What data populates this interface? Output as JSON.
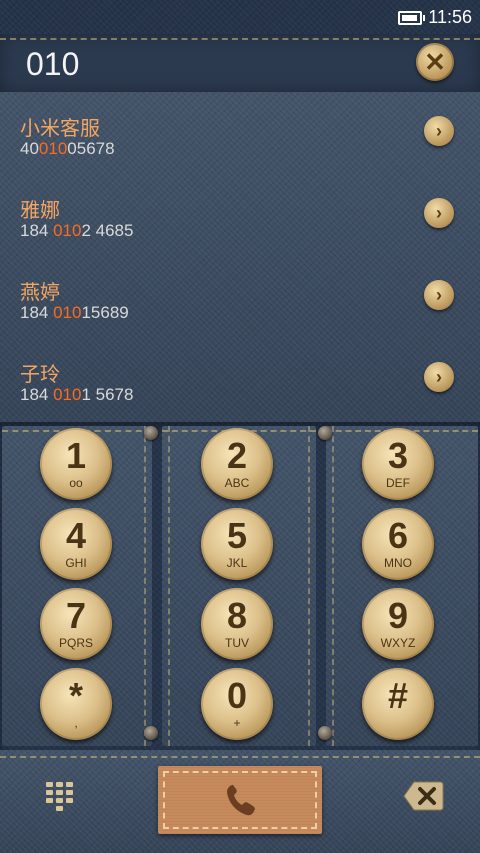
{
  "status_bar": {
    "time": "11:56",
    "icons": [
      "battery-icon"
    ]
  },
  "dial_input": {
    "value": "010",
    "clear_icon": "close-icon"
  },
  "contacts": [
    {
      "name": "小米客服",
      "number_prefix": "40",
      "number_match": "010",
      "number_suffix": "05678"
    },
    {
      "name": "雅娜",
      "number_prefix": "184 ",
      "number_match": "010",
      "number_suffix": "2 4685"
    },
    {
      "name": "燕婷",
      "number_prefix": "184 ",
      "number_match": "010",
      "number_suffix": "15689"
    },
    {
      "name": "子玲",
      "number_prefix": "184 ",
      "number_match": "010",
      "number_suffix": "1 5678"
    }
  ],
  "keypad": {
    "keys": [
      {
        "digit": "1",
        "letters": "ᴏᴏ"
      },
      {
        "digit": "2",
        "letters": "ABC"
      },
      {
        "digit": "3",
        "letters": "DEF"
      },
      {
        "digit": "4",
        "letters": "GHI"
      },
      {
        "digit": "5",
        "letters": "JKL"
      },
      {
        "digit": "6",
        "letters": "MNO"
      },
      {
        "digit": "7",
        "letters": "PQRS"
      },
      {
        "digit": "8",
        "letters": "TUV"
      },
      {
        "digit": "9",
        "letters": "WXYZ"
      },
      {
        "digit": "*",
        "letters": ","
      },
      {
        "digit": "0",
        "letters": "+"
      },
      {
        "digit": "#",
        "letters": ""
      }
    ]
  },
  "bottom_bar": {
    "icons": [
      "dialpad-icon",
      "phone-icon",
      "backspace-icon"
    ]
  },
  "colors": {
    "highlight": "#ff6a1a",
    "contact_name": "#f2a662",
    "denim": "#3c4d63",
    "button_brass": "#dcc08a",
    "call_leather": "#c68a5c"
  }
}
